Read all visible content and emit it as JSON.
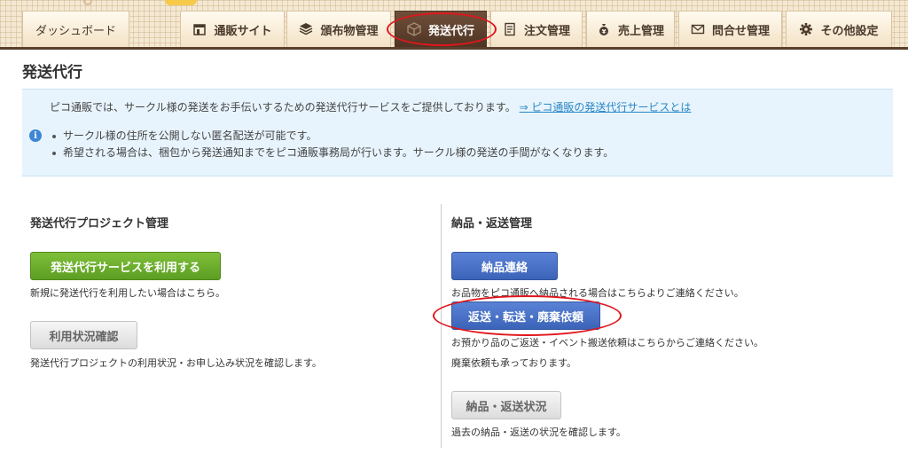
{
  "nav": {
    "tabs": [
      {
        "label": "ダッシュボード",
        "icon": "none"
      },
      {
        "label": "通販サイト",
        "icon": "storefront-icon"
      },
      {
        "label": "頒布物管理",
        "icon": "boxes-icon"
      },
      {
        "label": "発送代行",
        "icon": "package-icon"
      },
      {
        "label": "注文管理",
        "icon": "document-icon"
      },
      {
        "label": "売上管理",
        "icon": "money-bag-icon"
      },
      {
        "label": "問合せ管理",
        "icon": "envelope-icon"
      },
      {
        "label": "その他設定",
        "icon": "gear-icon"
      }
    ],
    "active_index": 3,
    "accent_color": "#5a3f2c"
  },
  "page": {
    "title": "発送代行"
  },
  "info": {
    "intro": "ピコ通販では、サークル様の発送をお手伝いするための発送代行サービスをご提供しております。",
    "link": "⇒ ピコ通販の発送代行サービスとは",
    "bullets": [
      "サークル様の住所を公開しない匿名配送が可能です。",
      "希望される場合は、梱包から発送通知までをピコ通販事務局が行います。サークル様の発送の手間がなくなります。"
    ]
  },
  "left_section": {
    "heading": "発送代行プロジェクト管理",
    "use_service_button": "発送代行サービスを利用する",
    "use_service_desc": "新規に発送代行を利用したい場合はこちら。",
    "status_button": "利用状況確認",
    "status_desc": "発送代行プロジェクトの利用状況・お申し込み状況を確認します。"
  },
  "right_section": {
    "heading": "納品・返送管理",
    "delivery_button": "納品連絡",
    "delivery_desc": "お品物をピコ通販へ納品される場合はこちらよりご連絡ください。",
    "return_button": "返送・転送・廃棄依頼",
    "return_desc_1": "お預かり品のご返送・イベント搬送依頼はこちらからご連絡ください。",
    "return_desc_2": "廃棄依頼も承っております。",
    "history_button": "納品・返送状況",
    "history_desc": "過去の納品・返送の状況を確認します。"
  },
  "colors": {
    "highlight": "#e0161d",
    "green_button": "#6aae2c",
    "blue_button": "#4a72c8",
    "info_bg": "#e8f4fd",
    "link": "#2a86c5"
  }
}
